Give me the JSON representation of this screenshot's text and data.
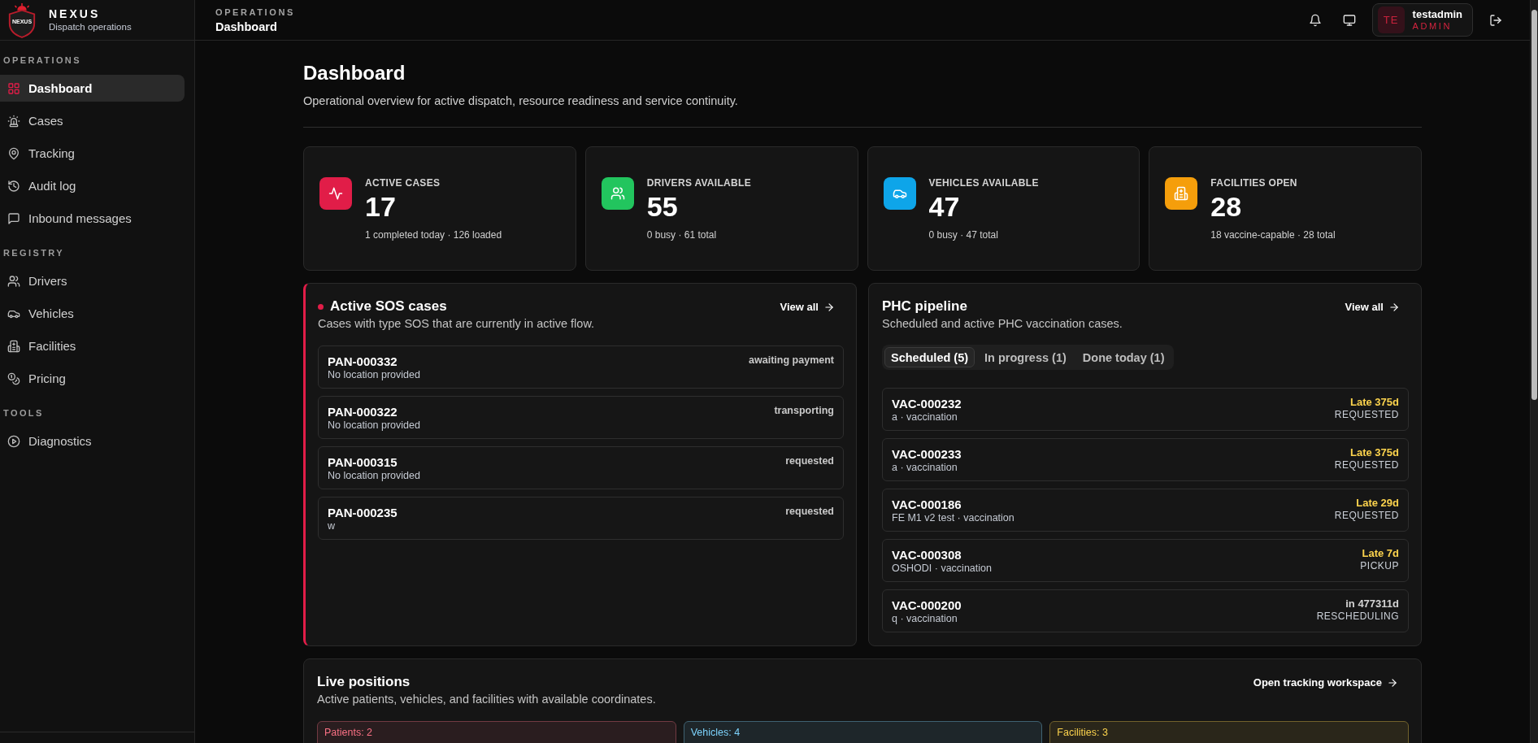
{
  "sidebar": {
    "brand": {
      "logo_text": "NEXUS",
      "name": "NEXUS",
      "tagline": "Dispatch operations"
    },
    "sections": [
      {
        "heading": "OPERATIONS",
        "items": [
          {
            "label": "Dashboard",
            "selected": true
          },
          {
            "label": "Cases",
            "selected": false
          },
          {
            "label": "Tracking",
            "selected": false
          },
          {
            "label": "Audit log",
            "selected": false
          },
          {
            "label": "Inbound messages",
            "selected": false
          }
        ]
      },
      {
        "heading": "REGISTRY",
        "items": [
          {
            "label": "Drivers",
            "selected": false
          },
          {
            "label": "Vehicles",
            "selected": false
          },
          {
            "label": "Facilities",
            "selected": false
          },
          {
            "label": "Pricing",
            "selected": false
          }
        ]
      },
      {
        "heading": "TOOLS",
        "items": [
          {
            "label": "Diagnostics",
            "selected": false
          }
        ]
      }
    ]
  },
  "header": {
    "section": "OPERATIONS",
    "page": "Dashboard",
    "user": {
      "initials": "TE",
      "name": "testadmin",
      "role": "ADMIN"
    }
  },
  "page": {
    "title": "Dashboard",
    "subtitle": "Operational overview for active dispatch, resource readiness and service continuity."
  },
  "stats": [
    {
      "label": "ACTIVE CASES",
      "value": "17",
      "detail": "1 completed today · 126 loaded",
      "color": "#e11d48"
    },
    {
      "label": "DRIVERS AVAILABLE",
      "value": "55",
      "detail": "0 busy · 61 total",
      "color": "#22c55e"
    },
    {
      "label": "VEHICLES AVAILABLE",
      "value": "47",
      "detail": "0 busy · 47 total",
      "color": "#0ea5e9"
    },
    {
      "label": "FACILITIES OPEN",
      "value": "28",
      "detail": "18 vaccine-capable · 28 total",
      "color": "#f59e0b"
    }
  ],
  "sos_cases": {
    "title": "Active SOS cases",
    "subtitle": "Cases with type SOS that are currently in active flow.",
    "link": "View all",
    "rows": [
      {
        "id": "PAN-000332",
        "location": "No location provided",
        "status": "awaiting payment"
      },
      {
        "id": "PAN-000322",
        "location": "No location provided",
        "status": "transporting"
      },
      {
        "id": "PAN-000315",
        "location": "No location provided",
        "status": "requested"
      },
      {
        "id": "PAN-000235",
        "location": "w",
        "status": "requested"
      }
    ]
  },
  "pipeline": {
    "title": "PHC pipeline",
    "subtitle": "Scheduled and active PHC vaccination cases.",
    "link": "View all",
    "tabs": [
      {
        "label": "Scheduled (5)",
        "selected": true
      },
      {
        "label": "In progress (1)",
        "selected": false
      },
      {
        "label": "Done today (1)",
        "selected": false
      }
    ],
    "rows": [
      {
        "id": "VAC-000232",
        "detail": "a · vaccination",
        "due": "Late 375d",
        "overdue": true,
        "status": "REQUESTED"
      },
      {
        "id": "VAC-000233",
        "detail": "a · vaccination",
        "due": "Late 375d",
        "overdue": true,
        "status": "REQUESTED"
      },
      {
        "id": "VAC-000186",
        "detail": "FE M1 v2 test · vaccination",
        "due": "Late 29d",
        "overdue": true,
        "status": "REQUESTED"
      },
      {
        "id": "VAC-000308",
        "detail": "OSHODI · vaccination",
        "due": "Late 7d",
        "overdue": true,
        "status": "PICKUP"
      },
      {
        "id": "VAC-000200",
        "detail": "q · vaccination",
        "due": "in 477311d",
        "overdue": false,
        "status": "RESCHEDULING"
      }
    ]
  },
  "live_positions": {
    "title": "Live positions",
    "subtitle": "Active patients, vehicles, and facilities with available coordinates.",
    "link": "Open tracking workspace",
    "groups": [
      {
        "label": "Patients: 2",
        "color": "#fb7185"
      },
      {
        "label": "Vehicles: 4",
        "color": "#7dd3fc"
      },
      {
        "label": "Facilities: 3",
        "color": "#fcd34d"
      }
    ]
  }
}
